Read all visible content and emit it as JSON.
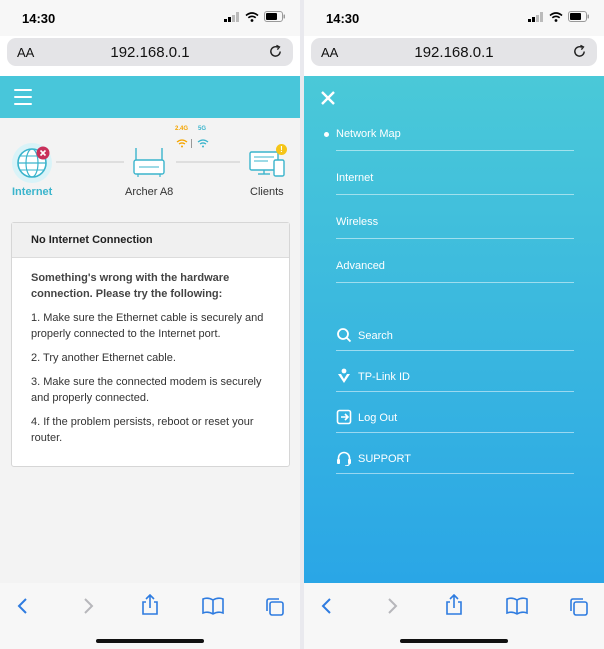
{
  "status_bar": {
    "time": "14:30"
  },
  "browser": {
    "aa_label": "AA",
    "url": "192.168.0.1"
  },
  "network_map": {
    "internet_label": "Internet",
    "router_label": "Archer A8",
    "clients_label": "Clients",
    "band_24": "2.4G",
    "band_5": "5G",
    "clients_badge": "!"
  },
  "alert": {
    "title": "No Internet Connection",
    "intro": "Something's wrong with the hardware connection. Please try the following:",
    "steps": [
      "1. Make sure the Ethernet cable is securely and properly connected to the Internet port.",
      "2. Try another Ethernet cable.",
      "3. Make sure the connected modem is securely and properly connected.",
      "4. If the problem persists, reboot or reset your router."
    ]
  },
  "menu": {
    "items": [
      "Network Map",
      "Internet",
      "Wireless",
      "Advanced"
    ],
    "active_index": 0,
    "extra": [
      {
        "label": "Search",
        "icon": "search-icon"
      },
      {
        "label": "TP-Link ID",
        "icon": "tplink-id-icon"
      },
      {
        "label": "Log Out",
        "icon": "logout-icon"
      },
      {
        "label": "SUPPORT",
        "icon": "support-headset-icon"
      }
    ]
  },
  "colors": {
    "accent": "#48c6da",
    "menu_gradient_top": "#4ac9d8",
    "menu_gradient_bottom": "#2aa6e6",
    "ios_blue": "#2f7ce0",
    "error": "#c8305a",
    "warning": "#f5c518"
  }
}
